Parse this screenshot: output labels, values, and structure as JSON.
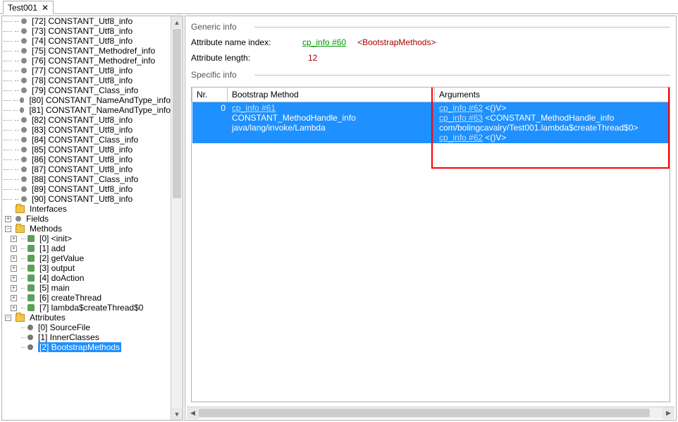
{
  "tab": {
    "title": "Test001",
    "close": "✕"
  },
  "tree": {
    "constants": [
      {
        "idx": "[72]",
        "type": "CONSTANT_Utf8_info"
      },
      {
        "idx": "[73]",
        "type": "CONSTANT_Utf8_info"
      },
      {
        "idx": "[74]",
        "type": "CONSTANT_Utf8_info"
      },
      {
        "idx": "[75]",
        "type": "CONSTANT_Methodref_info"
      },
      {
        "idx": "[76]",
        "type": "CONSTANT_Methodref_info"
      },
      {
        "idx": "[77]",
        "type": "CONSTANT_Utf8_info"
      },
      {
        "idx": "[78]",
        "type": "CONSTANT_Utf8_info"
      },
      {
        "idx": "[79]",
        "type": "CONSTANT_Class_info"
      },
      {
        "idx": "[80]",
        "type": "CONSTANT_NameAndType_info"
      },
      {
        "idx": "[81]",
        "type": "CONSTANT_NameAndType_info"
      },
      {
        "idx": "[82]",
        "type": "CONSTANT_Utf8_info"
      },
      {
        "idx": "[83]",
        "type": "CONSTANT_Utf8_info"
      },
      {
        "idx": "[84]",
        "type": "CONSTANT_Class_info"
      },
      {
        "idx": "[85]",
        "type": "CONSTANT_Utf8_info"
      },
      {
        "idx": "[86]",
        "type": "CONSTANT_Utf8_info"
      },
      {
        "idx": "[87]",
        "type": "CONSTANT_Utf8_info"
      },
      {
        "idx": "[88]",
        "type": "CONSTANT_Class_info"
      },
      {
        "idx": "[89]",
        "type": "CONSTANT_Utf8_info"
      },
      {
        "idx": "[90]",
        "type": "CONSTANT_Utf8_info"
      }
    ],
    "sections": {
      "interfaces": "Interfaces",
      "fields": "Fields",
      "methods": "Methods",
      "attributes": "Attributes"
    },
    "methods": [
      {
        "idx": "[0]",
        "name": "<init>",
        "exp": "+"
      },
      {
        "idx": "[1]",
        "name": "add",
        "exp": "+"
      },
      {
        "idx": "[2]",
        "name": "getValue",
        "exp": "+"
      },
      {
        "idx": "[3]",
        "name": "output",
        "exp": "+"
      },
      {
        "idx": "[4]",
        "name": "doAction",
        "exp": "+"
      },
      {
        "idx": "[5]",
        "name": "main",
        "exp": "+"
      },
      {
        "idx": "[6]",
        "name": "createThread",
        "exp": "+"
      },
      {
        "idx": "[7]",
        "name": "lambda$createThread$0",
        "exp": "+"
      }
    ],
    "attributes": [
      {
        "idx": "[0]",
        "name": "SourceFile",
        "selected": false
      },
      {
        "idx": "[1]",
        "name": "InnerClasses",
        "selected": false
      },
      {
        "idx": "[2]",
        "name": "BootstrapMethods",
        "selected": true
      }
    ]
  },
  "generic": {
    "title": "Generic info",
    "attr_name_idx_label": "Attribute name index:",
    "attr_name_idx_link": "cp_info #60",
    "attr_name_idx_desc": "<BootstrapMethods>",
    "attr_len_label": "Attribute length:",
    "attr_len_value": "12"
  },
  "specific": {
    "title": "Specific info"
  },
  "table": {
    "headers": {
      "nr": "Nr.",
      "method": "Bootstrap Method",
      "args": "Arguments"
    },
    "row": {
      "nr": "0",
      "method_link": "cp_info #61",
      "method_desc": "CONSTANT_MethodHandle_info java/lang/invoke/Lambda",
      "args": [
        {
          "link": "cp_info #62",
          "desc": " <()V>"
        },
        {
          "link": "cp_info #63",
          "desc": " <CONSTANT_MethodHandle_info com/bolingcavalry/Test001.lambda$createThread$0>"
        },
        {
          "link": "cp_info #62",
          "desc": " <()V>"
        }
      ]
    }
  }
}
